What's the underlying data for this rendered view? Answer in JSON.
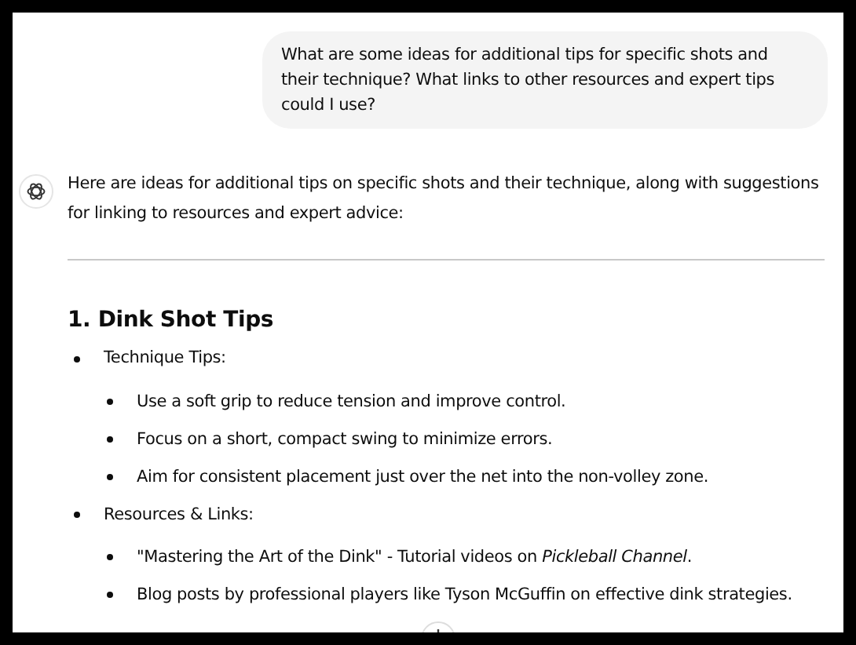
{
  "user_message": {
    "text": "What are some ideas for additional tips for specific shots and their technique? What links to other resources and expert tips could I use?"
  },
  "assistant_message": {
    "intro": "Here are ideas for additional tips on specific shots and their technique, along with suggestions for linking to resources and expert advice:",
    "sections": [
      {
        "heading": "1. Dink Shot Tips",
        "items": [
          {
            "label": "Technique Tips:",
            "children": [
              "Use a soft grip to reduce tension and improve control.",
              "Focus on a short, compact swing to minimize errors.",
              "Aim for consistent placement just over the net into the non-volley zone."
            ]
          },
          {
            "label": "Resources & Links:",
            "children": [
              "\"Mastering the Art of the Dink\" - Tutorial videos on *Pickleball Channel*.",
              "Blog posts by professional players like Tyson McGuffin on effective dink strategies."
            ]
          }
        ]
      }
    ]
  }
}
